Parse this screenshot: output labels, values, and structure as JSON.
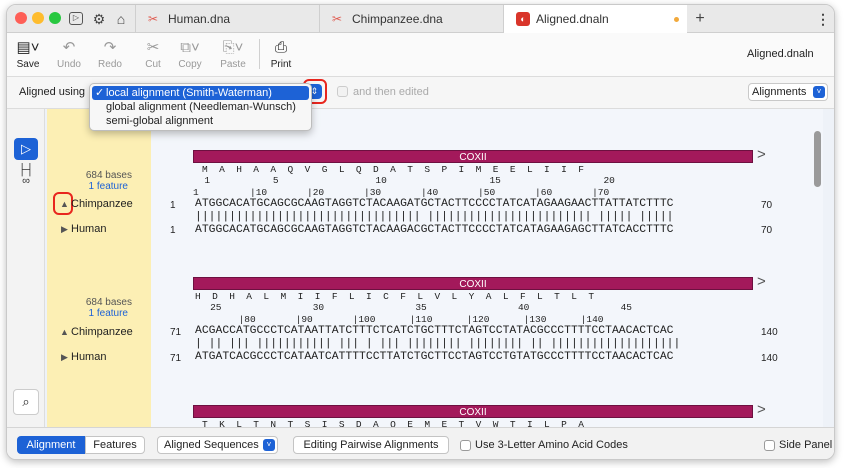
{
  "tabs": [
    {
      "label": "Human.dna"
    },
    {
      "label": "Chimpanzee.dna"
    },
    {
      "label": "Aligned.dnaln"
    }
  ],
  "toolbar": {
    "save": "Save",
    "undo": "Undo",
    "redo": "Redo",
    "cut": "Cut",
    "copy": "Copy",
    "paste": "Paste",
    "print": "Print",
    "doc_title": "Aligned.dnaln"
  },
  "options": {
    "aligned_using_label": "Aligned using",
    "dropdown_items": [
      "local alignment  (Smith-Waterman)",
      "global alignment  (Needleman-Wunsch)",
      "semi-global alignment"
    ],
    "selected_item": "local alignment  (Smith-Waterman)",
    "then_edited": "and then edited",
    "view_select": "Alignments"
  },
  "blocks": [
    {
      "bases": "684 bases",
      "feature": "1 feature",
      "feature_name": "COXII",
      "aa": "M  A  H  A  A  Q  V  G  L  Q  D  A  T  S  P  I  M  E  E  L  I  I  F",
      "aa_nums": "  1           5                 10                  15                  20",
      "ruler": "1         |10       |20       |30       |40       |50       |60       |70",
      "seqs": [
        {
          "name": "Chimpanzee",
          "start": "1",
          "end": "70",
          "seq": "ATGGCACATGCAGCGCAAGTAGGTCTACAAGATGCTACTTCCCCTATCATAGAAGAACTTATTATCTTTC"
        },
        {
          "name": "Human",
          "start": "1",
          "end": "70",
          "seq": "ATGGCACATGCAGCGCAAGTAGGTCTACAAGACGCTACTTCCCCTATCATAGAAGAGCTTATCACCTTTC"
        }
      ],
      "match": "||||||||||||||||||||||||||||||||| |||||||||||||||||||||||| ||||| |||||"
    },
    {
      "bases": "684 bases",
      "feature": "1 feature",
      "feature_name": "COXII",
      "aa": "H  D  H  A  L  M  I  I  F  L  I  C  F  L  V  L  Y  A  L  F  L  T  L  T",
      "aa_nums": "   25                30                35                40                45",
      "ruler": "        |80       |90       |100      |110      |120      |130      |140",
      "seqs": [
        {
          "name": "Chimpanzee",
          "start": "71",
          "end": "140",
          "seq": "ACGACCATGCCCTCATAATTATCTTTCTCATCTGCTTTCTAGTCCTATACGCCCTTTTCCTAACACTCAC"
        },
        {
          "name": "Human",
          "start": "71",
          "end": "140",
          "seq": "ATGATCACGCCCTCATAATCATTTTCCTTATCTGCTTCCTAGTCCTGTATGCCCTTTTCCTAACACTCAC"
        }
      ],
      "match": "| || ||| ||||||||||| ||| | ||| |||||||| |||||||| || |||||||||||||||||||"
    },
    {
      "feature_name": "COXII",
      "aa": "T  K  L  T  N  T  S  I  S  D  A  Q  E  M  E  T  V  W  T  I  L  P  A"
    }
  ],
  "bottom": {
    "tab_alignment": "Alignment",
    "tab_features": "Features",
    "seq_select": "Aligned Sequences",
    "edit_button": "Editing Pairwise Alignments",
    "three_letter": "Use 3-Letter Amino Acid Codes",
    "side_panel": "Side Panel"
  },
  "colors": {
    "accent": "#1d62d6",
    "feature": "#a3195b",
    "name_column": "#fcefb4",
    "highlight": "#e8261e"
  }
}
